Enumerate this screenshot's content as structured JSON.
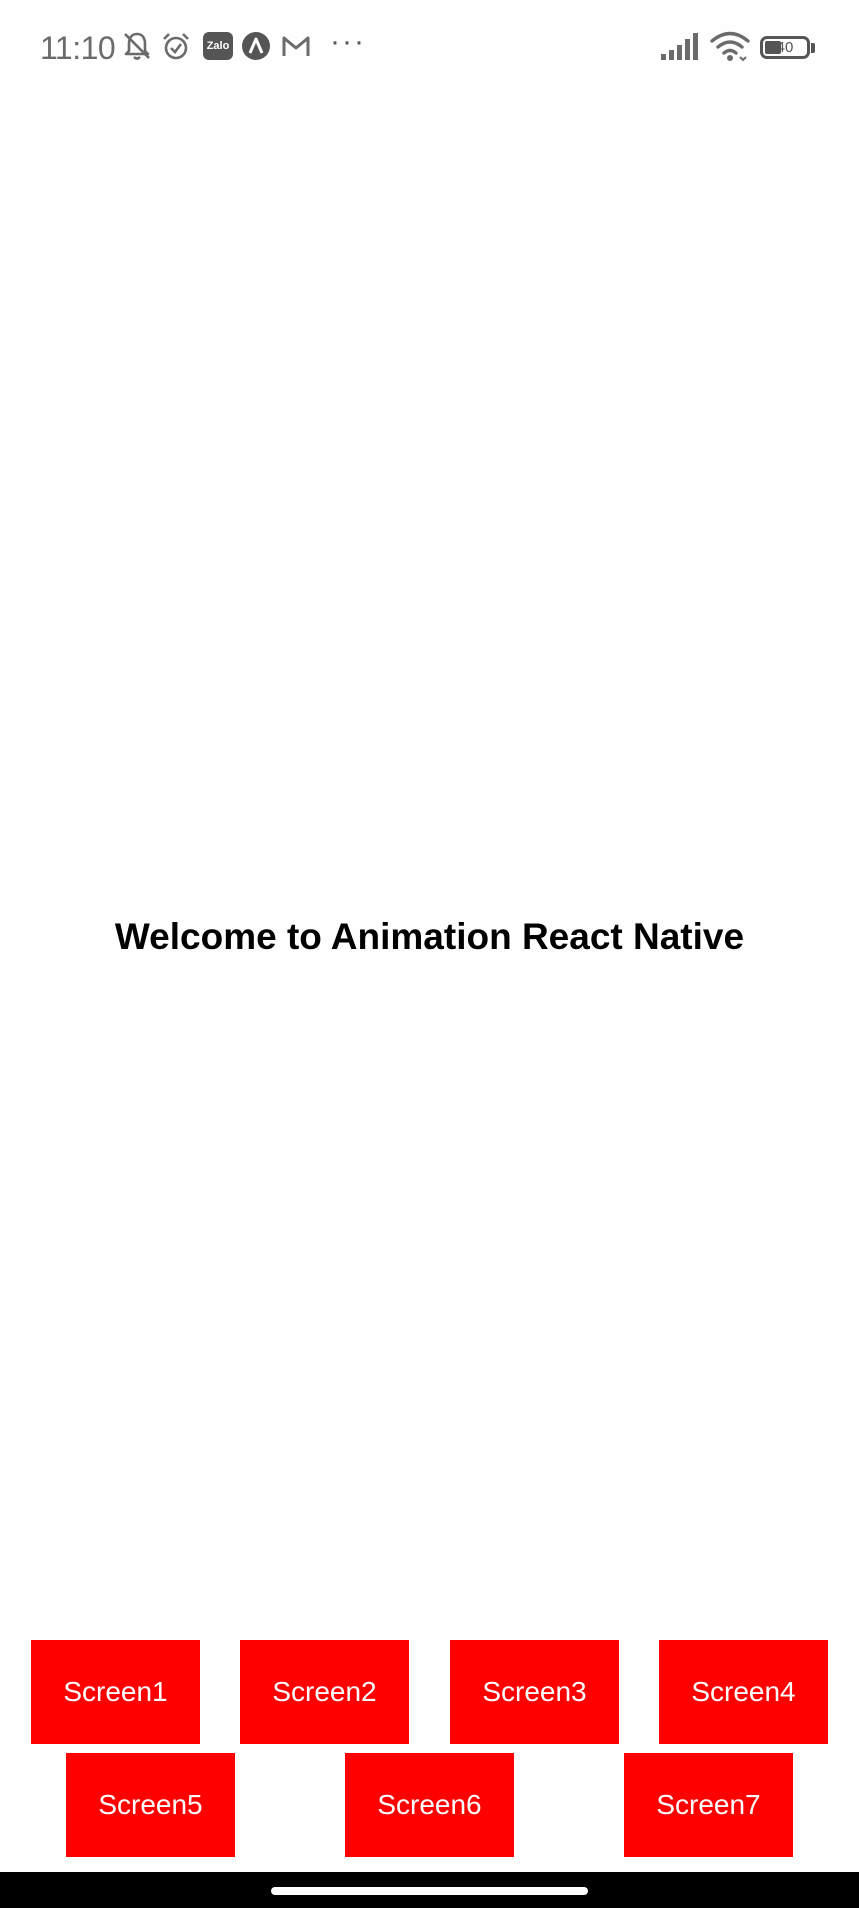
{
  "status_bar": {
    "time": "11:10",
    "battery_level": "40",
    "battery_fraction": 0.4,
    "zalo_label": "Zalo",
    "more": "···",
    "icons": [
      "bell-off-icon",
      "alarm-icon",
      "zalo-icon",
      "arc-icon",
      "gmail-icon",
      "more-icon",
      "signal-icon",
      "wifi-icon",
      "battery-icon"
    ]
  },
  "main": {
    "title": "Welcome to Animation React Native"
  },
  "buttons": {
    "screen1": "Screen1",
    "screen2": "Screen2",
    "screen3": "Screen3",
    "screen4": "Screen4",
    "screen5": "Screen5",
    "screen6": "Screen6",
    "screen7": "Screen7"
  },
  "colors": {
    "button_bg": "#ff0000",
    "button_text": "#ffffff",
    "title_text": "#000000",
    "nav_bar": "#000000"
  }
}
